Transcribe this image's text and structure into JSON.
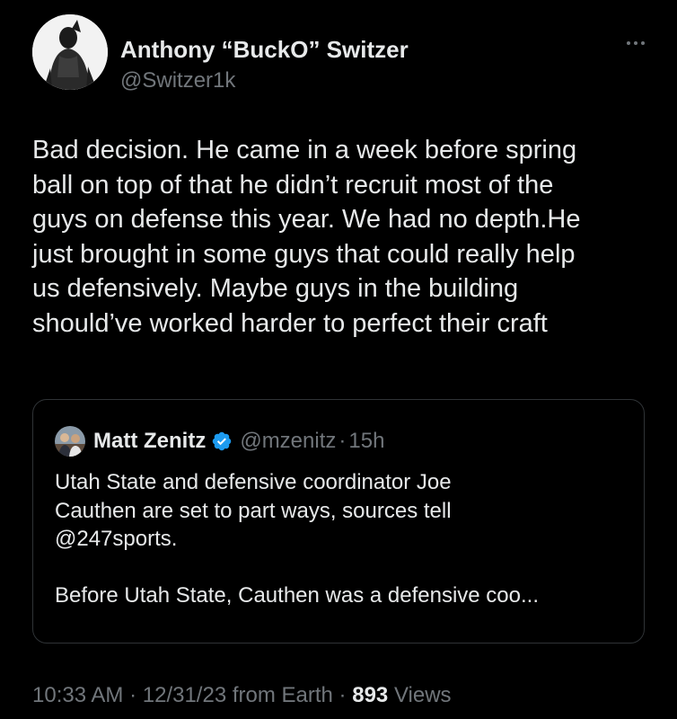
{
  "tweet": {
    "author": {
      "name": "Anthony “BuckO” Switzer",
      "handle": "@Switzer1k"
    },
    "text_lines": [
      "Bad decision. He came in a week before spring",
      "ball on top of that he didn’t recruit most of the",
      "guys on defense this year. We had no depth.He",
      "just brought in some guys that could really help",
      "us defensively. Maybe guys in the building",
      "should’ve worked harder to perfect their craft"
    ],
    "more_icon": "ellipsis-icon"
  },
  "quote": {
    "author": {
      "name": "Matt Zenitz",
      "handle": "@mzenitz",
      "separator": "·",
      "time": "15h"
    },
    "verified_icon": "verified-badge-icon",
    "text_lines": [
      "Utah State and defensive coordinator Joe",
      "Cauthen are set to part ways, sources tell",
      "@247sports.",
      "",
      "Before Utah State, Cauthen was a defensive coo..."
    ]
  },
  "meta": {
    "time": "10:33 AM",
    "sep1": "·",
    "date": "12/31/23",
    "source": "from Earth",
    "sep2": "·",
    "views_count": "893",
    "views_label": "Views"
  },
  "colors": {
    "background": "#000000",
    "primary_text": "#e7e9ea",
    "secondary_text": "#71767b",
    "border": "#2f3336",
    "verified": "#1d9bf0"
  }
}
